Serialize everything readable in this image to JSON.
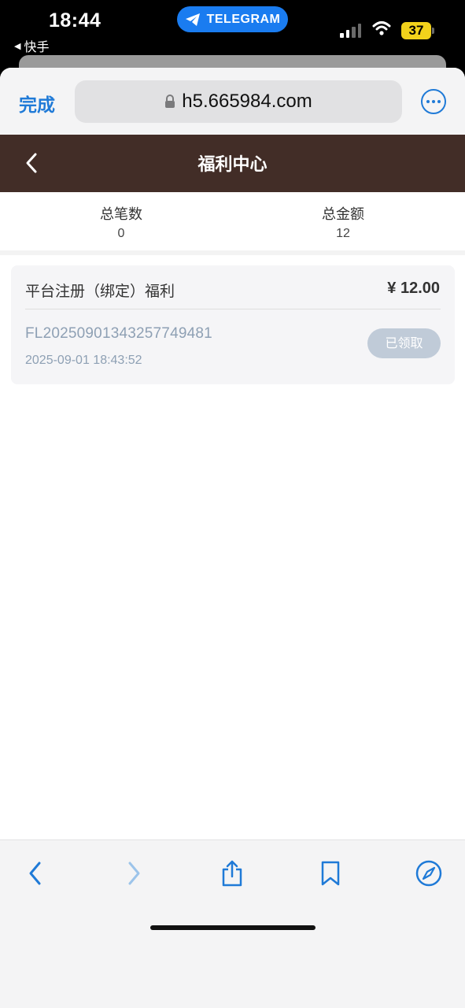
{
  "status_bar": {
    "time": "18:44",
    "back_app": "快手",
    "telegram_pill": "TELEGRAM",
    "battery": "37"
  },
  "browser": {
    "done_label": "完成",
    "url": "h5.665984.com"
  },
  "header": {
    "title": "福利中心"
  },
  "stats": {
    "count_label": "总笔数",
    "count_value": "0",
    "amount_label": "总金额",
    "amount_value": "12"
  },
  "records": [
    {
      "title": "平台注册（绑定）福利",
      "amount": "¥ 12.00",
      "id": "FL20250901343257749481",
      "datetime": "2025-09-01 18:43:52",
      "status": "已领取"
    }
  ],
  "colors": {
    "header_bg": "#422d27",
    "accent_blue": "#1f7ad7",
    "telegram_blue": "#1a7cf0",
    "battery_yellow": "#f2d21b",
    "claimed_button": "#c0cbd8"
  },
  "icons": {
    "back": "chevron-left-icon",
    "lock": "lock-icon",
    "more": "ellipsis-circle-icon",
    "share": "share-icon",
    "bookmark": "bookmark-icon",
    "compass": "compass-icon"
  }
}
